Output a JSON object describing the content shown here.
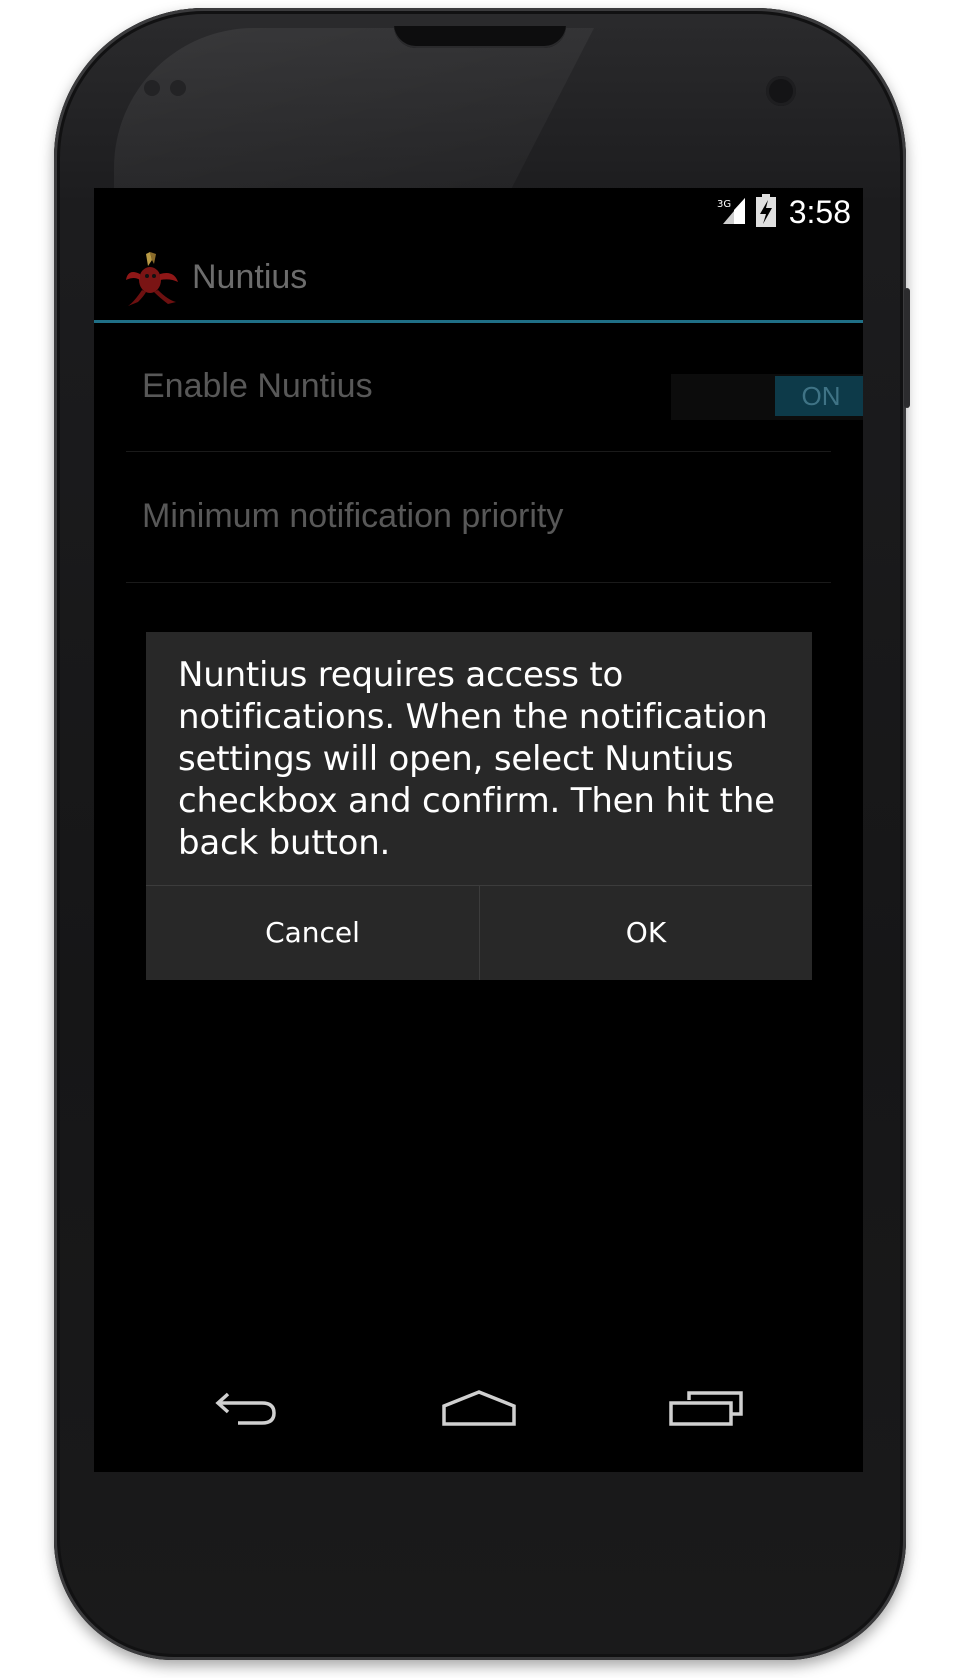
{
  "status_bar": {
    "network": "3G",
    "time": "3:58"
  },
  "action_bar": {
    "app_name": "Nuntius"
  },
  "preferences": [
    {
      "label": "Enable Nuntius",
      "switch_label": "ON"
    },
    {
      "label": "Minimum notification priority"
    }
  ],
  "dialog": {
    "message": "Nuntius requires access to notifications. When the notification settings will open, select Nuntius checkbox and confirm. Then hit the back button.",
    "cancel_label": "Cancel",
    "ok_label": "OK"
  },
  "colors": {
    "accent_divider": "#1f6f86",
    "switch_on": "#0d3a49",
    "dialog_background": "#282828"
  },
  "icons": {
    "app": "lobster-icon",
    "network": "signal-3g-icon",
    "battery": "battery-charging-icon",
    "nav_back": "back-arrow-icon",
    "nav_home": "home-icon",
    "nav_recent": "recent-apps-icon"
  }
}
